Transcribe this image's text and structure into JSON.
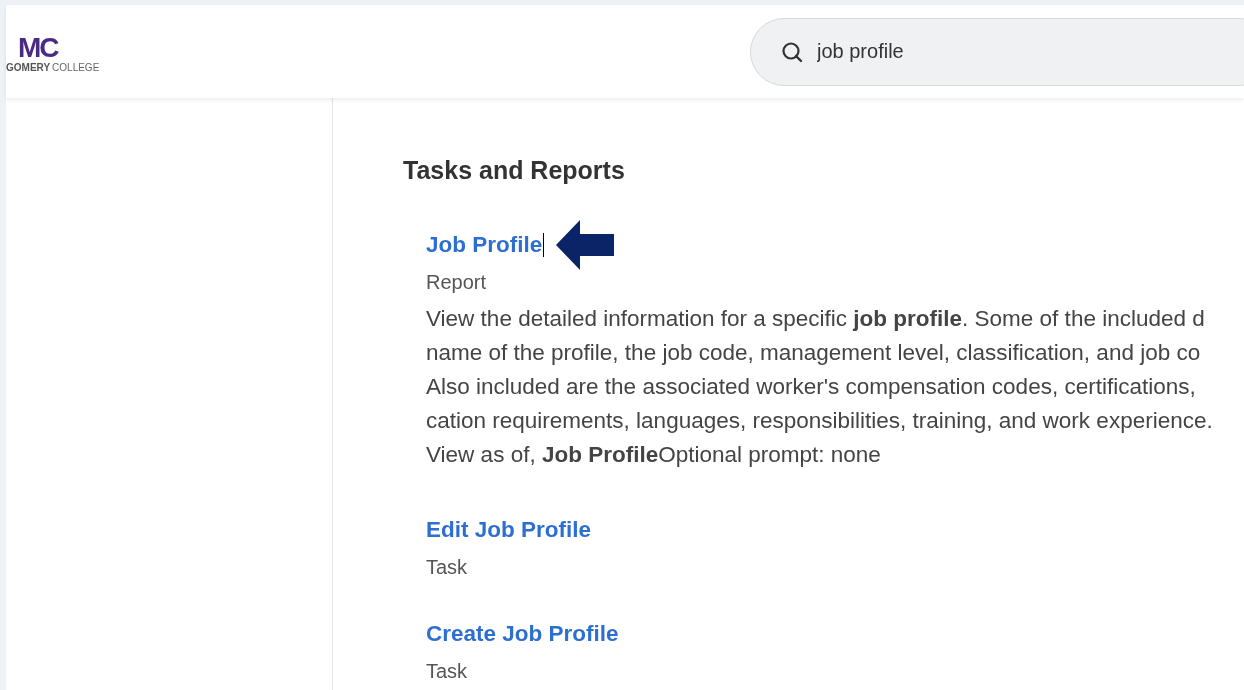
{
  "logo": {
    "mark": "MC",
    "name_bold": "GOMERY",
    "name_rest": "COLLEGE"
  },
  "search": {
    "value": "job profile"
  },
  "section_title": "Tasks and Reports",
  "results": [
    {
      "title": "Job Profile",
      "type": "Report",
      "cursor": true,
      "arrow": true,
      "description_lines": [
        "View the detailed information for a specific **job profile**. Some of the included d",
        "name of the profile, the job code, management level, classification, and job co",
        "Also included are the associated worker's compensation codes, certifications,",
        "cation requirements, languages, responsibilities, training, and work experience.",
        "View as of, **Job Profile**Optional prompt: none"
      ]
    },
    {
      "title": "Edit Job Profile",
      "type": "Task"
    },
    {
      "title": "Create Job Profile",
      "type": "Task"
    }
  ]
}
